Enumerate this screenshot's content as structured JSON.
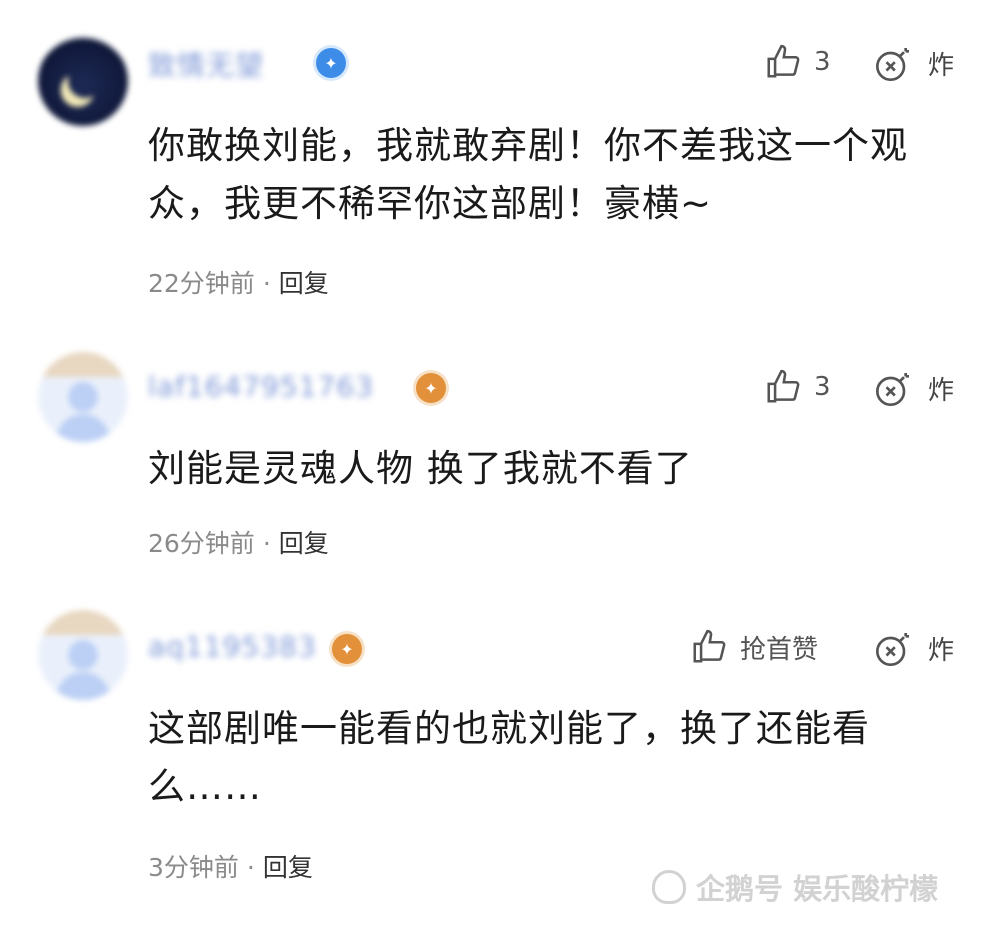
{
  "comments": [
    {
      "username": "致情无望",
      "like_label": "3",
      "bomb_label": "炸",
      "text": "你敢换刘能，我就敢弃剧！你不差我这一个观众，我更不稀罕你这部剧！豪横~",
      "time": "22分钟前",
      "separator": "·",
      "reply": "回复"
    },
    {
      "username": "laf1647951763",
      "like_label": "3",
      "bomb_label": "炸",
      "text": "刘能是灵魂人物 换了我就不看了",
      "time": "26分钟前",
      "separator": "·",
      "reply": "回复"
    },
    {
      "username": "aq1195383",
      "like_label": "抢首赞",
      "bomb_label": "炸",
      "text": "这部剧唯一能看的也就刘能了，换了还能看么……",
      "time": "3分钟前",
      "separator": "·",
      "reply": "回复"
    }
  ],
  "watermark": "企鹅号 娱乐酸柠檬",
  "colors": {
    "username": "#7d97d6",
    "badge_blue": "#3d8ce8",
    "badge_gold": "#e2913a",
    "meta": "#8a8a8a"
  },
  "icons": [
    "thumbs-up-icon",
    "bomb-icon",
    "badge-icon",
    "penguin-logo-icon"
  ]
}
